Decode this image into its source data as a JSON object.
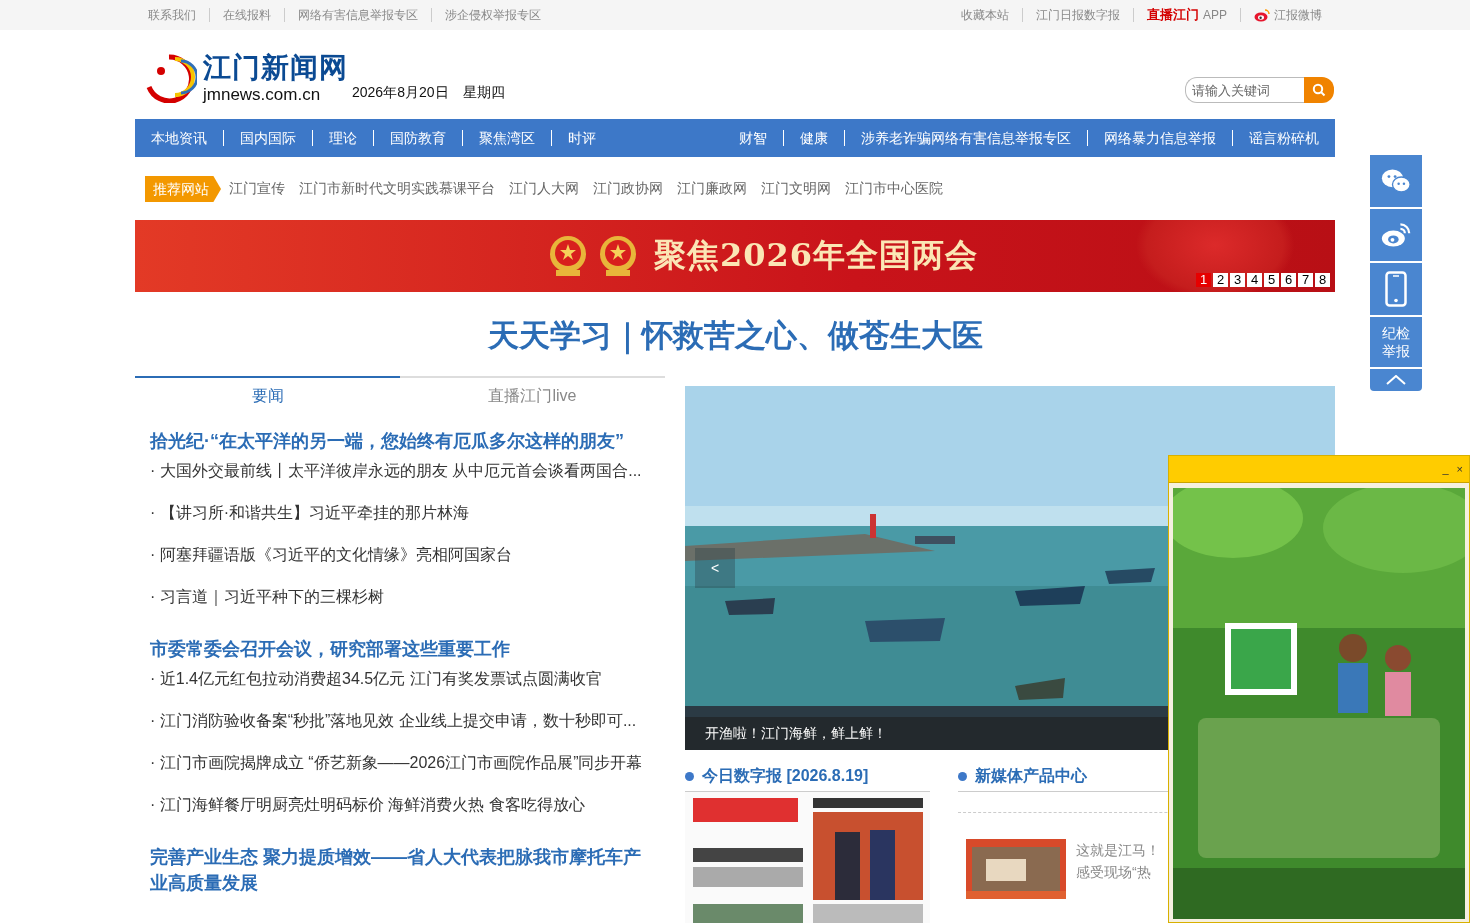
{
  "top_links_left": [
    "联系我们",
    "在线报料",
    "网络有害信息举报专区",
    "涉企侵权举报专区"
  ],
  "top_links_right": [
    {
      "kind": "text",
      "label": "收藏本站"
    },
    {
      "kind": "text",
      "label": "江门日报数字报"
    },
    {
      "kind": "app",
      "logo": "直播江门",
      "label": "APP"
    },
    {
      "kind": "weibo",
      "label": "江报微博"
    }
  ],
  "header": {
    "site_name": "江门新闻网",
    "domain": "jmnews.com.cn",
    "date": "2026年8月20日",
    "weekday": "星期四",
    "search": {
      "placeholder": "请输入关键词"
    }
  },
  "nav": {
    "left": [
      "本地资讯",
      "国内国际",
      "理论",
      "国防教育",
      "聚焦湾区",
      "时评"
    ],
    "right": [
      "财智",
      "健康",
      "涉养老诈骗网络有害信息举报专区",
      "网络暴力信息举报",
      "谣言粉碎机"
    ]
  },
  "recommended": {
    "label": "推荐网站",
    "links": [
      "江门宣传",
      "江门市新时代文明实践慕课平台",
      "江门人大网",
      "江门政协网",
      "江门廉政网",
      "江门文明网",
      "江门市中心医院"
    ]
  },
  "banner": {
    "title": "聚焦2026年全国两会",
    "pages": [
      {
        "label": "1",
        "selected": true
      },
      {
        "label": "2",
        "selected": false
      },
      {
        "label": "3",
        "selected": false
      },
      {
        "label": "4",
        "selected": false
      },
      {
        "label": "5",
        "selected": false
      },
      {
        "label": "6",
        "selected": false
      },
      {
        "label": "7",
        "selected": false
      },
      {
        "label": "8",
        "selected": false
      }
    ]
  },
  "headline": "天天学习｜怀救苦之心、做苍生大医",
  "news_tabs": [
    {
      "label": "要闻",
      "selected": true
    },
    {
      "label": "直播江门live",
      "selected": false
    }
  ],
  "news_groups": [
    {
      "title": "拾光纪·“在太平洋的另一端，您始终有厄瓜多尔这样的朋友”",
      "items": [
        "· 大国外交最前线丨太平洋彼岸永远的朋友 从中厄元首会谈看两国合...",
        "· 【讲习所·和谐共生】习近平牵挂的那片林海",
        "· 阿塞拜疆语版《习近平的文化情缘》亮相阿国家台",
        "· 习言道｜习近平种下的三棵杉树"
      ]
    },
    {
      "title": "市委常委会召开会议，研究部署这些重要工作",
      "items": [
        "· 近1.4亿元红包拉动消费超34.5亿元 江门有奖发票试点圆满收官",
        "· 江门消防验收备案“秒批”落地见效 企业线上提交申请，数十秒即可...",
        "· 江门市画院揭牌成立 “侨艺新象——2026江门市画院作品展”同步开幕",
        "· 江门海鲜餐厅明厨亮灶明码标价 海鲜消费火热 食客吃得放心"
      ]
    },
    {
      "title": "完善产业生态 聚力提质增效——省人大代表把脉我市摩托车产业高质量发展"
    }
  ],
  "slider": {
    "caption": "开渔啦！江门海鲜，鲜上鲜！",
    "prev": "<"
  },
  "digital_paper": {
    "title": "今日数字报 [2026.8.19]"
  },
  "new_media": {
    "title": "新媒体产品中心",
    "items": [
      {
        "lines": [
          "这就是江马！",
          "感受现场“热"
        ]
      }
    ]
  },
  "side_tools": [
    {
      "kind": "wechat"
    },
    {
      "kind": "weibo"
    },
    {
      "kind": "phone"
    },
    {
      "kind": "text",
      "label": "纪检举报"
    },
    {
      "kind": "top"
    }
  ],
  "popup": {
    "minimize": "_",
    "close": "×"
  }
}
